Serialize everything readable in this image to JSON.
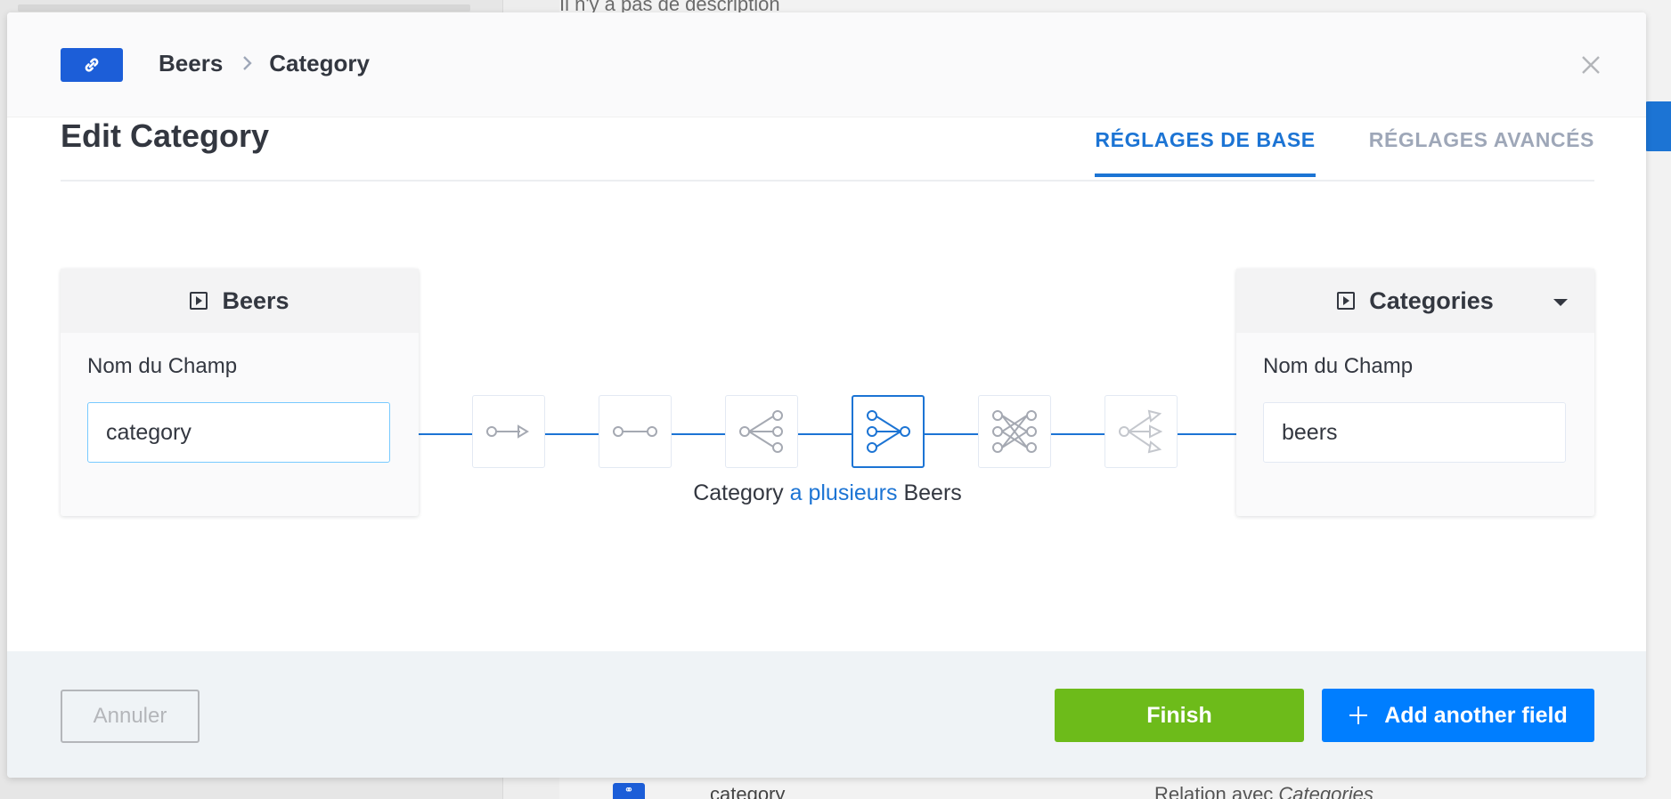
{
  "background": {
    "description_text": "Il n'y a pas de description",
    "bottom_row": {
      "field_name": "category",
      "relation_prefix": "Relation avec ",
      "relation_target": "Categories"
    }
  },
  "header": {
    "link_icon": "link-icon",
    "breadcrumb": [
      "Beers",
      "Category"
    ],
    "close_icon": "close-icon"
  },
  "main": {
    "title": "Edit Category",
    "tabs": [
      {
        "label": "RÉGLAGES DE BASE",
        "active": true
      },
      {
        "label": "RÉGLAGES AVANCÉS",
        "active": false
      }
    ]
  },
  "relation": {
    "left": {
      "content_type": "Beers",
      "field_label": "Nom du Champ",
      "field_value": "category"
    },
    "right": {
      "content_type": "Categories",
      "field_label": "Nom du Champ",
      "field_value": "beers"
    },
    "types": [
      {
        "icon": "one-way-icon",
        "selected": false
      },
      {
        "icon": "one-to-one-icon",
        "selected": false
      },
      {
        "icon": "one-to-many-icon",
        "selected": false
      },
      {
        "icon": "many-to-one-icon",
        "selected": true
      },
      {
        "icon": "many-to-many-icon",
        "selected": false
      },
      {
        "icon": "many-way-icon",
        "selected": false
      }
    ],
    "caption": {
      "subject": "Category",
      "relation": "a plusieurs",
      "object": "Beers"
    }
  },
  "footer": {
    "cancel_label": "Annuler",
    "finish_label": "Finish",
    "add_label": "Add another field",
    "add_icon": "plus-icon"
  },
  "colors": {
    "primary": "#1c74d4",
    "finish": "#6dbb1a",
    "add": "#007eff"
  }
}
